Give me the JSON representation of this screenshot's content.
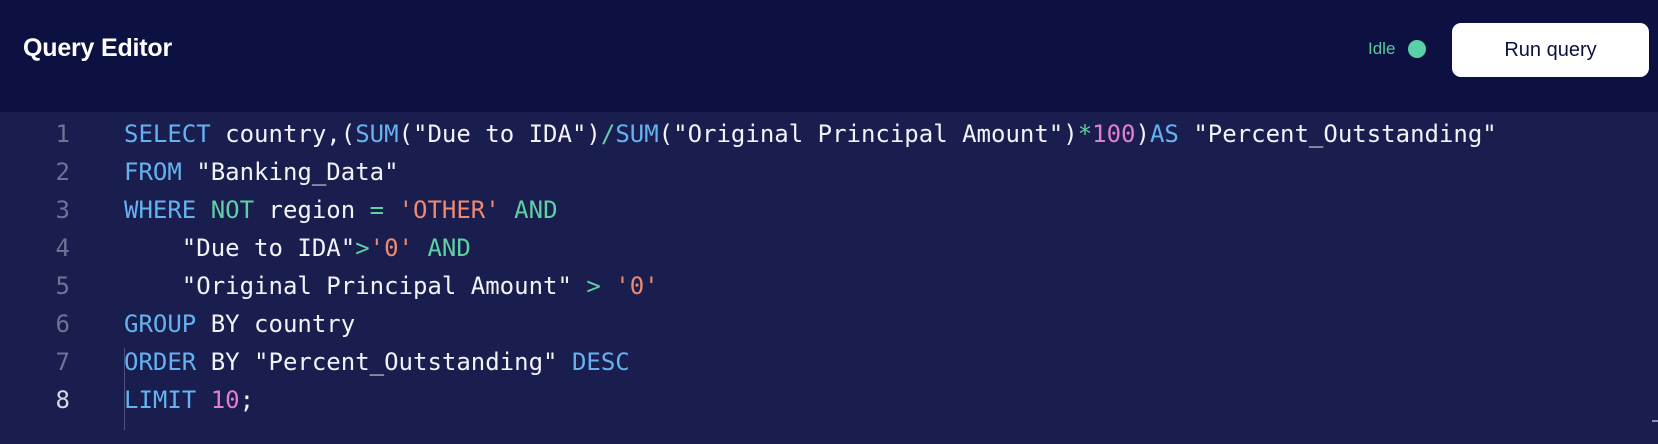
{
  "header": {
    "title": "Query Editor",
    "status_label": "Idle",
    "status_color": "#5ad0a6",
    "run_button_label": "Run query"
  },
  "editor": {
    "active_line": 8,
    "lines": [
      {
        "number": "1",
        "tokens": [
          {
            "text": "SELECT",
            "type": "keyword"
          },
          {
            "text": " country,(",
            "type": "plain"
          },
          {
            "text": "SUM",
            "type": "keyword"
          },
          {
            "text": "(\"Due to IDA\")",
            "type": "plain"
          },
          {
            "text": "/",
            "type": "operator"
          },
          {
            "text": "SUM",
            "type": "keyword"
          },
          {
            "text": "(\"Original Principal Amount\")",
            "type": "plain"
          },
          {
            "text": "*",
            "type": "operator"
          },
          {
            "text": "100",
            "type": "number"
          },
          {
            "text": ")",
            "type": "plain"
          },
          {
            "text": "AS",
            "type": "keyword"
          },
          {
            "text": " \"Percent_Outstanding\"",
            "type": "plain"
          }
        ]
      },
      {
        "number": "2",
        "tokens": [
          {
            "text": "FROM",
            "type": "keyword"
          },
          {
            "text": " \"Banking_Data\"",
            "type": "plain"
          }
        ]
      },
      {
        "number": "3",
        "tokens": [
          {
            "text": "WHERE",
            "type": "keyword"
          },
          {
            "text": " ",
            "type": "plain"
          },
          {
            "text": "NOT",
            "type": "operator"
          },
          {
            "text": " region ",
            "type": "plain"
          },
          {
            "text": "=",
            "type": "operator"
          },
          {
            "text": " ",
            "type": "plain"
          },
          {
            "text": "'OTHER'",
            "type": "string"
          },
          {
            "text": " ",
            "type": "plain"
          },
          {
            "text": "AND",
            "type": "operator"
          }
        ]
      },
      {
        "number": "4",
        "tokens": [
          {
            "text": "    \"Due to IDA\"",
            "type": "plain"
          },
          {
            "text": ">",
            "type": "operator"
          },
          {
            "text": "'0'",
            "type": "string"
          },
          {
            "text": " ",
            "type": "plain"
          },
          {
            "text": "AND",
            "type": "operator"
          }
        ]
      },
      {
        "number": "5",
        "tokens": [
          {
            "text": "    \"Original Principal Amount\" ",
            "type": "plain"
          },
          {
            "text": ">",
            "type": "operator"
          },
          {
            "text": " ",
            "type": "plain"
          },
          {
            "text": "'0'",
            "type": "string"
          }
        ]
      },
      {
        "number": "6",
        "tokens": [
          {
            "text": "GROUP",
            "type": "keyword"
          },
          {
            "text": " BY country",
            "type": "plain"
          }
        ]
      },
      {
        "number": "7",
        "tokens": [
          {
            "text": "ORDER",
            "type": "keyword"
          },
          {
            "text": " BY \"Percent_Outstanding\" ",
            "type": "plain"
          },
          {
            "text": "DESC",
            "type": "keyword"
          }
        ]
      },
      {
        "number": "8",
        "tokens": [
          {
            "text": "LIMIT",
            "type": "keyword"
          },
          {
            "text": " ",
            "type": "plain"
          },
          {
            "text": "10",
            "type": "number"
          },
          {
            "text": ";",
            "type": "plain"
          }
        ]
      }
    ]
  },
  "syntax_colors": {
    "keyword": "#66b2f0",
    "operator": "#5fd0a2",
    "number": "#e07fd2",
    "string": "#ee8a72",
    "plain": "#f2f3f8"
  }
}
